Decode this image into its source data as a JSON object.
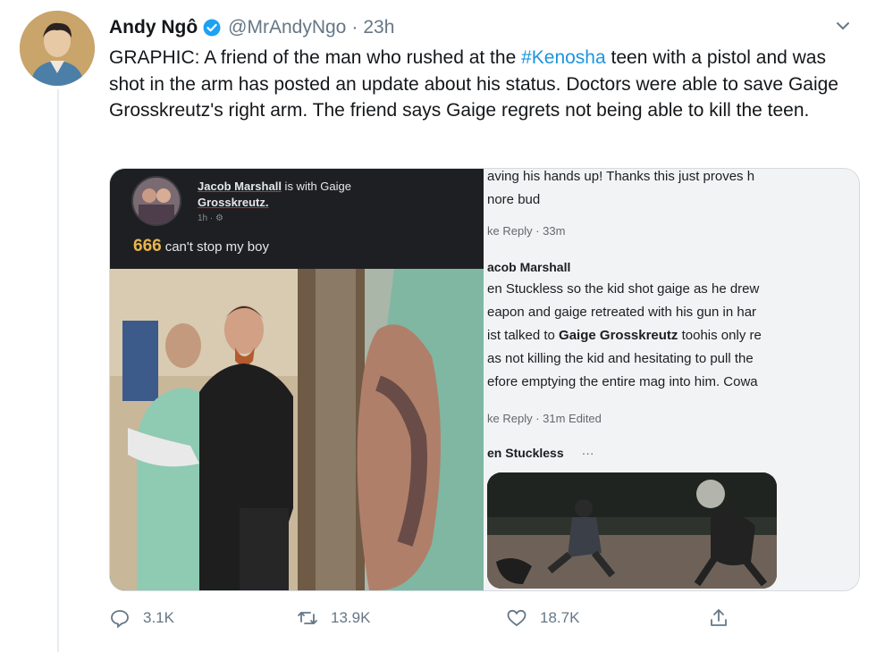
{
  "tweet": {
    "author_name": "Andy Ngô",
    "handle": "@MrAndyNgo",
    "separator": "·",
    "time": "23h",
    "text_before": "GRAPHIC: A friend of the man who rushed at the ",
    "hashtag": "#Kenosha",
    "text_after": " teen with a pistol and was shot in the arm has posted an update about his status. Doctors were able to save Gaige Grosskreutz's right arm. The friend says Gaige regrets not being able to kill the teen."
  },
  "media": {
    "fb_post": {
      "poster_name": "Jacob Marshall",
      "with_text": " is with Gaige",
      "tagged_name": "Grosskreutz.",
      "meta": "1h · ⚙",
      "emoji": "666",
      "caption": "can't stop my boy"
    },
    "comments": {
      "line1": "aving his hands up! Thanks this just proves h",
      "line2": "nore bud",
      "actions1": "ke  Reply · 33m",
      "name2": "acob Marshall",
      "body2_1": "en Stuckless so the kid shot gaige as he drew",
      "body2_2": "eapon and gaige retreated with his gun in har",
      "body2_3a": "ist talked to ",
      "body2_3b": "Gaige Grosskreutz",
      "body2_3c": " toohis only re",
      "body2_4": "as not killing the kid and hesitating to pull the",
      "body2_5": "efore emptying the entire mag into him. Cowa",
      "actions2": "ke  Reply · 31m   Edited",
      "name3": "en Stuckless",
      "more3": "···"
    }
  },
  "actions": {
    "reply_count": "3.1K",
    "retweet_count": "13.9K",
    "like_count": "18.7K"
  },
  "colors": {
    "link": "#1b95e0",
    "secondary": "#657786",
    "verified": "#1da1f2"
  }
}
